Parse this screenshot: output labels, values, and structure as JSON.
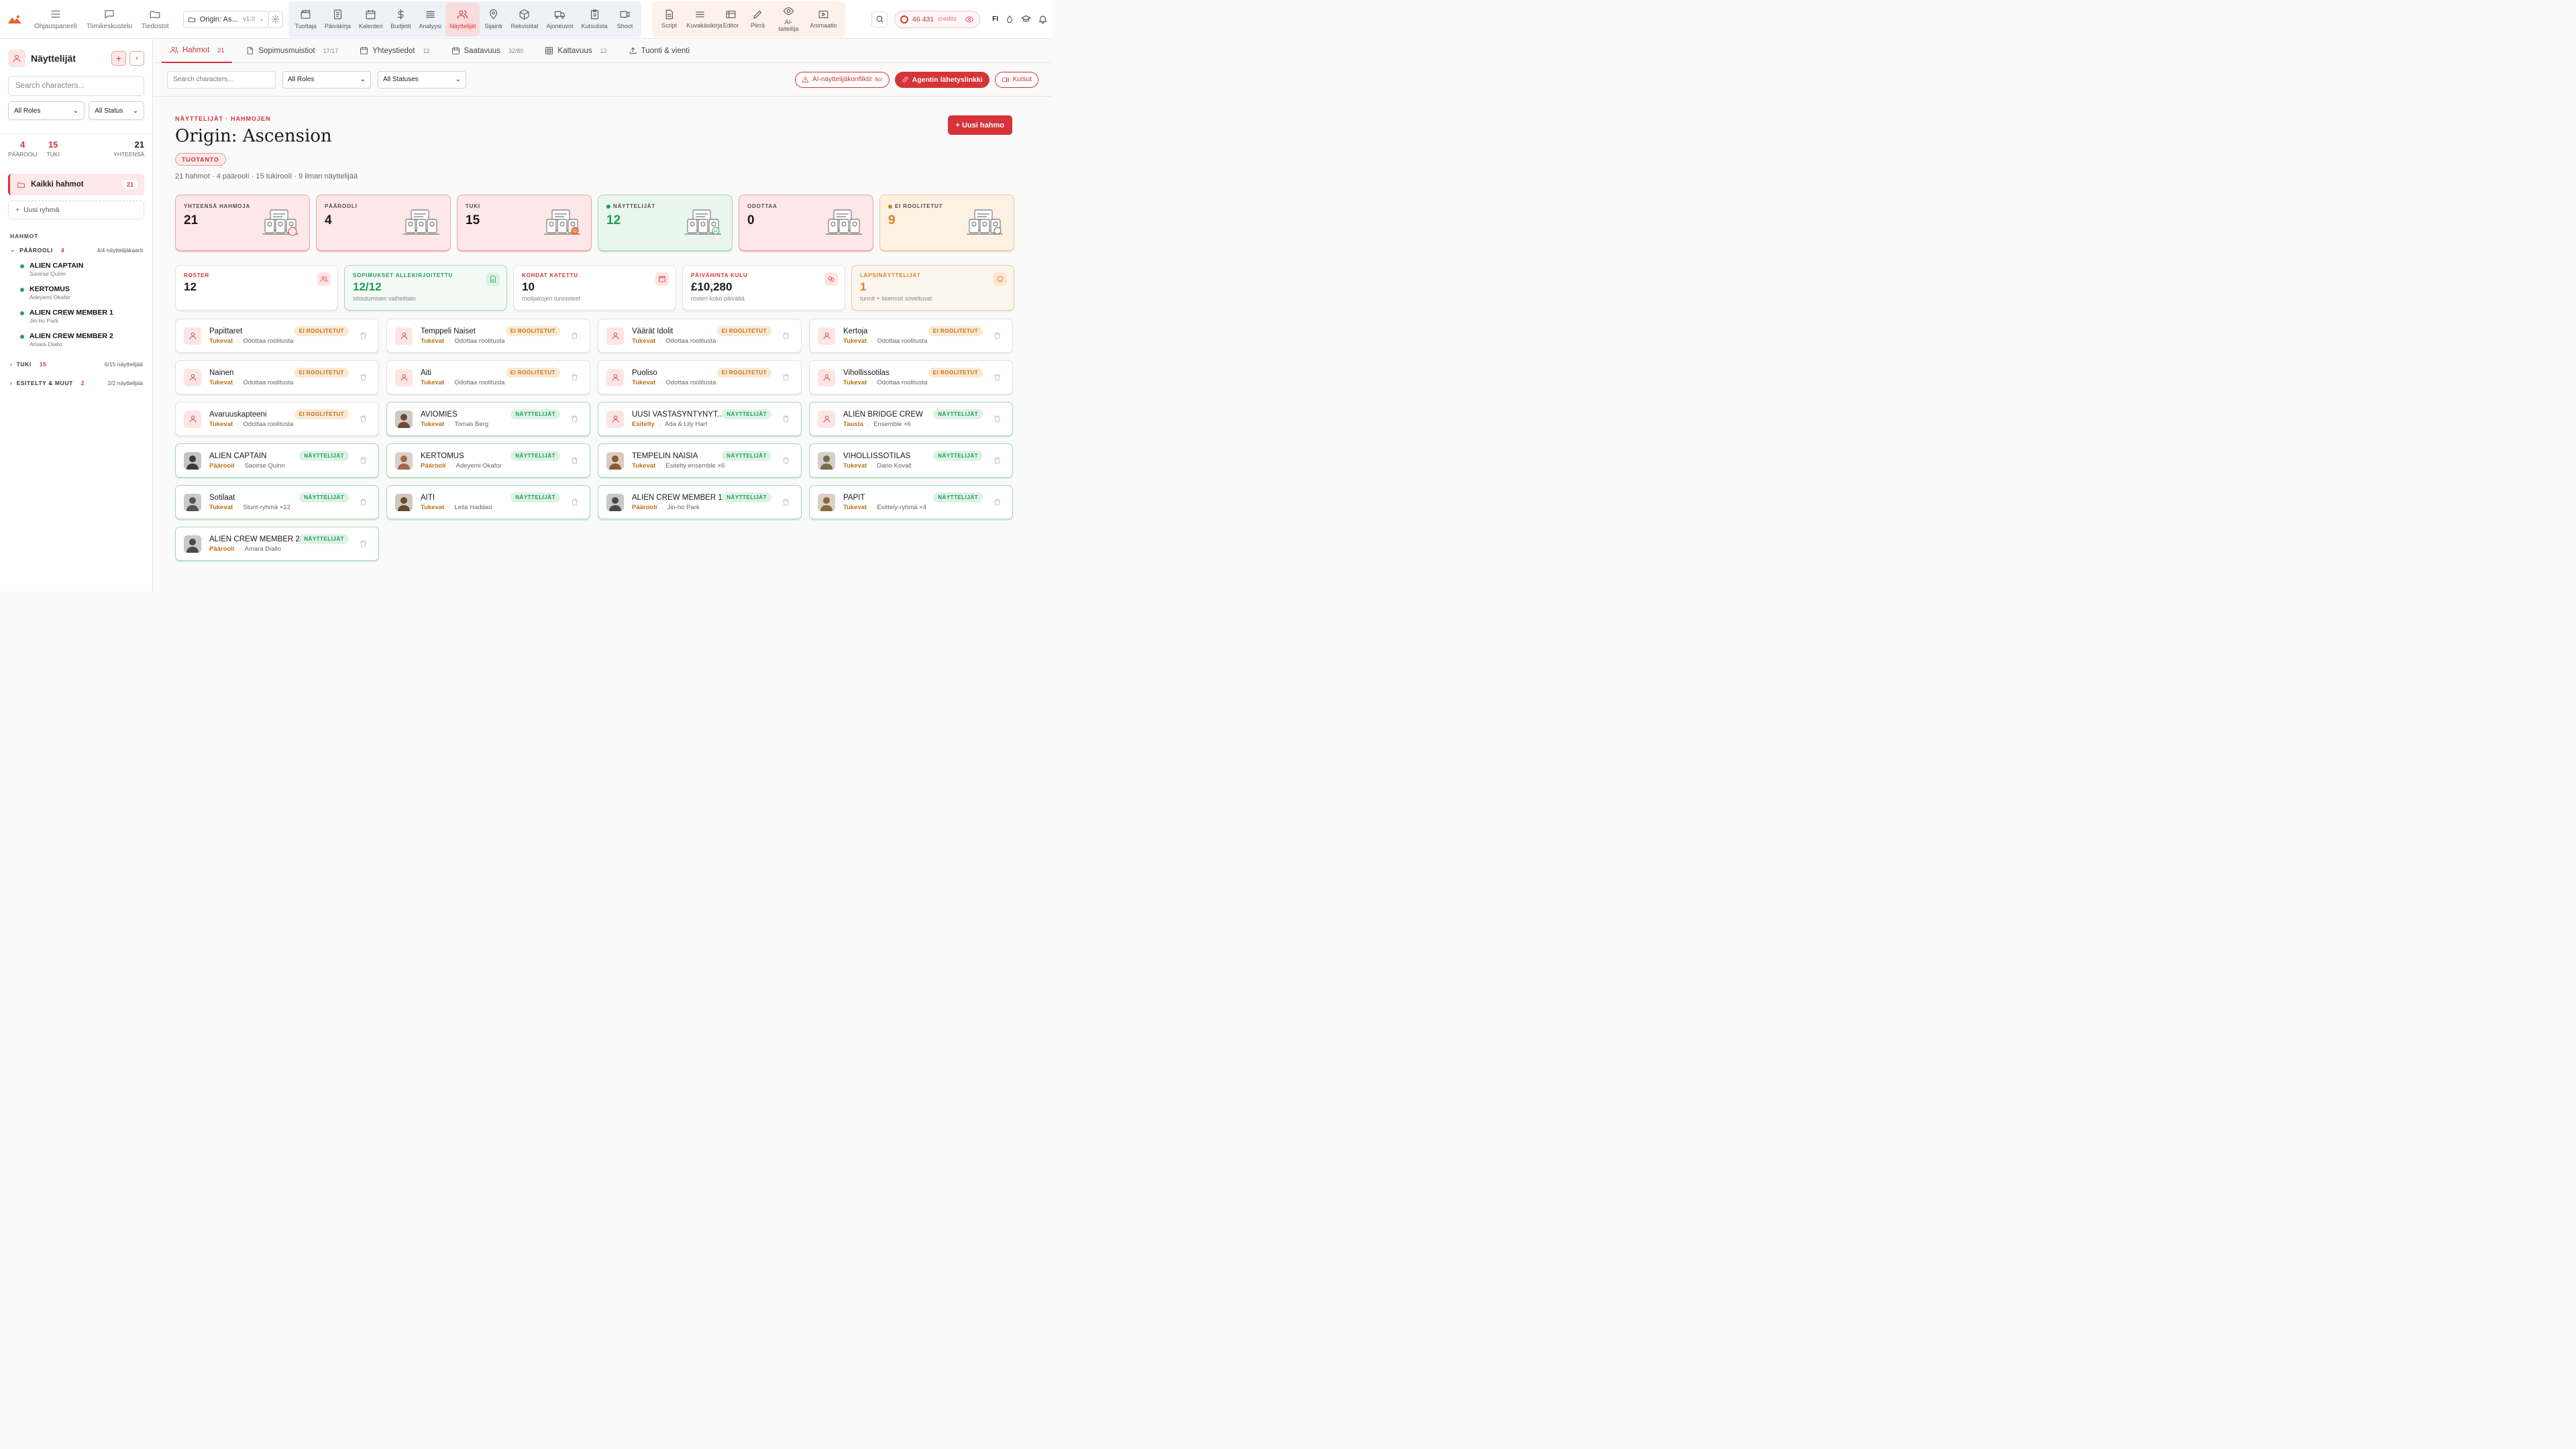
{
  "topnav": {
    "left": [
      {
        "label": "Ohjauspaneeli",
        "icon": "dashboard-icon"
      },
      {
        "label": "Tiimikeskustelu",
        "icon": "chat-icon"
      },
      {
        "label": "Tiedostot",
        "icon": "folder-icon"
      }
    ],
    "project": {
      "name": "Origin: As...",
      "version": "v1.0"
    },
    "tools": [
      {
        "label": "Tuottaja",
        "icon": "clapper-icon"
      },
      {
        "label": "Päiväkirja",
        "icon": "journal-icon"
      },
      {
        "label": "Kalenteri",
        "icon": "calendar-icon"
      },
      {
        "label": "Budjetti",
        "icon": "dollar-icon"
      },
      {
        "label": "Analyysi",
        "icon": "stack-icon"
      },
      {
        "label": "Näyttelijät",
        "icon": "people-icon"
      },
      {
        "label": "Sijainti",
        "icon": "pin-icon"
      },
      {
        "label": "Rekvisiitat",
        "icon": "cube-icon"
      },
      {
        "label": "Ajoneuvot",
        "icon": "truck-icon"
      },
      {
        "label": "Kutsulista",
        "icon": "clipboard-icon"
      },
      {
        "label": "Shoot",
        "icon": "camera-icon"
      }
    ],
    "creative": [
      {
        "label": "Script",
        "icon": "script-icon"
      },
      {
        "label": "Kuvakäsikirja",
        "icon": "lines-icon"
      },
      {
        "label": "Editor",
        "icon": "editor-icon"
      },
      {
        "label": "Piirrä",
        "icon": "pencil-icon"
      },
      {
        "label": "AI-taiteilija",
        "icon": "eye-icon"
      },
      {
        "label": "Animaatio",
        "icon": "play-icon"
      }
    ],
    "credits": "46 431",
    "credits_unit": "credits",
    "lang": "FI"
  },
  "sidebar": {
    "title": "Näyttelijät",
    "search_placeholder": "Search characters...",
    "role_filter": "All Roles",
    "status_filter": "All Status",
    "stats": [
      {
        "n": "4",
        "l": "PÄÄROOLI"
      },
      {
        "n": "15",
        "l": "TUKI"
      }
    ],
    "total": {
      "n": "21",
      "l": "YHTEENSÄ"
    },
    "all_group": {
      "label": "Kaikki hahmot",
      "count": "21"
    },
    "new_group": "Uusi ryhmä",
    "section": "HAHMOT",
    "groups": [
      {
        "name": "PÄÄROOLI",
        "count": "4",
        "right": "4/4 näyttelijäkaarti"
      },
      {
        "name": "TUKI",
        "count": "15",
        "right": "6/15 näyttelijää"
      },
      {
        "name": "ESITELTY & MUUT",
        "count": "2",
        "right": "2/2 näyttelijää"
      }
    ],
    "members": [
      {
        "name": "ALIEN CAPTAIN",
        "actor": "Saoirse Quinn"
      },
      {
        "name": "KERTOMUS",
        "actor": "Adeyemi Okafor"
      },
      {
        "name": "ALIEN CREW MEMBER 1",
        "actor": "Jin-ho Park"
      },
      {
        "name": "ALIEN CREW MEMBER 2",
        "actor": "Amara Diallo"
      }
    ]
  },
  "tabs": [
    {
      "label": "Hahmot",
      "count": "21",
      "icon": "people-icon"
    },
    {
      "label": "Sopimusmuistiot",
      "count": "17/17",
      "icon": "document-icon"
    },
    {
      "label": "Yhteystiedot",
      "count": "12",
      "icon": "contact-icon"
    },
    {
      "label": "Saatavuus",
      "count": "32/80",
      "icon": "calendar-icon"
    },
    {
      "label": "Kattavuus",
      "count": "12",
      "icon": "grid-icon"
    },
    {
      "label": "Tuonti & vienti",
      "count": "",
      "icon": "upload-icon"
    }
  ],
  "filters": {
    "search_placeholder": "Search characters...",
    "roles": "All Roles",
    "statuses": "All Statuses",
    "conflicts": "AI-näyttelijäkonfliktit",
    "conflicts_cost": "6cr",
    "agent_link": "Agentin lähetyslinkki",
    "invites": "Kutsut"
  },
  "header": {
    "crumb": "NÄYTTELIJÄT · HAHMOJEN",
    "title": "Origin: Ascension",
    "badge": "TUOTANTO",
    "subtitle": "21 hahmot · 4 pääroolí · 15 tukiroolí · 9 ilman näyttelijää",
    "new_button": "+ Uusi hahmo"
  },
  "kpis": [
    {
      "label": "YHTEENSÄ HAHMOJA",
      "value": "21",
      "tone": "red"
    },
    {
      "label": "PÄÄROOLI",
      "value": "4",
      "tone": "red"
    },
    {
      "label": "TUKI",
      "value": "15",
      "tone": "red"
    },
    {
      "label": "NÄYTTELIJÄT",
      "value": "12",
      "tone": "green"
    },
    {
      "label": "ODOTTAA",
      "value": "0",
      "tone": "red"
    },
    {
      "label": "EI ROOLITETUT",
      "value": "9",
      "tone": "orange"
    }
  ],
  "stats": [
    {
      "label": "ROSTER",
      "value": "12",
      "desc": "",
      "tone": "white",
      "icon": "people-icon"
    },
    {
      "label": "SOPIMUKSET ALLEKIRJOITETTU",
      "value": "12/12",
      "desc": "sitoutumisen vaiheittain",
      "tone": "green",
      "icon": "signed-icon"
    },
    {
      "label": "KOHDAT KATETTU",
      "value": "10",
      "desc": "roolijakojen tunnisteet",
      "tone": "white",
      "icon": "clapper-icon"
    },
    {
      "label": "PÄIVÄHINTA KULU",
      "value": "£10,280",
      "desc": "rosteri koko päivältä",
      "tone": "white",
      "icon": "coins-icon"
    },
    {
      "label": "LAPSINÄYTTELIJÄT",
      "value": "1",
      "desc": "tunnit + lisenssit soveltuvat",
      "tone": "orange",
      "icon": "child-icon"
    }
  ],
  "characters": [
    {
      "name": "Papittaret",
      "role": "Tukevat",
      "actor": "Odottaa roolitusta",
      "status": "EI ROOLITETUT",
      "cast": false,
      "avatar": ""
    },
    {
      "name": "Temppeli Naiset",
      "role": "Tukevat",
      "actor": "Odottaa roolitusta",
      "status": "EI ROOLITETUT",
      "cast": false,
      "avatar": ""
    },
    {
      "name": "Väärät Idolit",
      "role": "Tukevat",
      "actor": "Odottaa roolitusta",
      "status": "EI ROOLITETUT",
      "cast": false,
      "avatar": ""
    },
    {
      "name": "Kertoja",
      "role": "Tukevat",
      "actor": "Odottaa roolitusta",
      "status": "EI ROOLITETUT",
      "cast": false,
      "avatar": ""
    },
    {
      "name": "Nainen",
      "role": "Tukevat",
      "actor": "Odottaa roolitusta",
      "status": "EI ROOLITETUT",
      "cast": false,
      "avatar": ""
    },
    {
      "name": "Äiti",
      "role": "Tukevat",
      "actor": "Odottaa roolitusta",
      "status": "EI ROOLITETUT",
      "cast": false,
      "avatar": ""
    },
    {
      "name": "Puoliso",
      "role": "Tukevat",
      "actor": "Odottaa roolitusta",
      "status": "EI ROOLITETUT",
      "cast": false,
      "avatar": ""
    },
    {
      "name": "Vihollissotilas",
      "role": "Tukevat",
      "actor": "Odottaa roolitusta",
      "status": "EI ROOLITETUT",
      "cast": false,
      "avatar": ""
    },
    {
      "name": "Avaruuskapteeni",
      "role": "Tukevat",
      "actor": "Odottaa roolitusta",
      "status": "EI ROOLITETUT",
      "cast": false,
      "avatar": ""
    },
    {
      "name": "AVIOMIES",
      "role": "Tukevat",
      "actor": "Tomas Berg",
      "status": "NÄYTTELIJÄT",
      "cast": true,
      "avatar": "#6b4a35"
    },
    {
      "name": "UUSI VASTASYNTYNYT...",
      "role": "Esitelty",
      "actor": "Ada & Lily Hart",
      "status": "NÄYTTELIJÄT",
      "cast": true,
      "avatar": ""
    },
    {
      "name": "ALIEN BRIDGE CREW",
      "role": "Tausta",
      "actor": "Ensemble ×6",
      "status": "NÄYTTELIJÄT",
      "cast": true,
      "avatar": ""
    },
    {
      "name": "ALIEN CAPTAIN",
      "role": "Pääroolí",
      "actor": "Saoirse Quinn",
      "status": "NÄYTTELIJÄT",
      "cast": true,
      "avatar": "#3a3a3a"
    },
    {
      "name": "KERTOMUS",
      "role": "Pääroolí",
      "actor": "Adeyemi Okafor",
      "status": "NÄYTTELIJÄT",
      "cast": true,
      "avatar": "#a0684a"
    },
    {
      "name": "TEMPELIN NAISIA",
      "role": "Tukevat",
      "actor": "Esitelty ensemble ×6",
      "status": "NÄYTTELIJÄT",
      "cast": true,
      "avatar": "#8a5a34"
    },
    {
      "name": "VIHOLLISSOTILAS",
      "role": "Tukevat",
      "actor": "Dario Kovač",
      "status": "NÄYTTELIJÄT",
      "cast": true,
      "avatar": "#7a6a4a"
    },
    {
      "name": "Sotilaat",
      "role": "Tukevat",
      "actor": "Stunt-ryhmä ×12",
      "status": "NÄYTTELIJÄT",
      "cast": true,
      "avatar": "#555"
    },
    {
      "name": "ÄITI",
      "role": "Tukevat",
      "actor": "Leila Haddad",
      "status": "NÄYTTELIJÄT",
      "cast": true,
      "avatar": "#6a4a2e"
    },
    {
      "name": "ALIEN CREW MEMBER 1",
      "role": "Pääroolí",
      "actor": "Jin-ho Park",
      "status": "NÄYTTELIJÄT",
      "cast": true,
      "avatar": "#4a4a4a"
    },
    {
      "name": "PAPIT",
      "role": "Tukevat",
      "actor": "Esittely-ryhmä ×4",
      "status": "NÄYTTELIJÄT",
      "cast": true,
      "avatar": "#8a6a3a"
    },
    {
      "name": "ALIEN CREW MEMBER 2",
      "role": "Pääroolí",
      "actor": "Amara Diallo",
      "status": "NÄYTTELIJÄT",
      "cast": true,
      "avatar": "#4a4a4a"
    }
  ]
}
